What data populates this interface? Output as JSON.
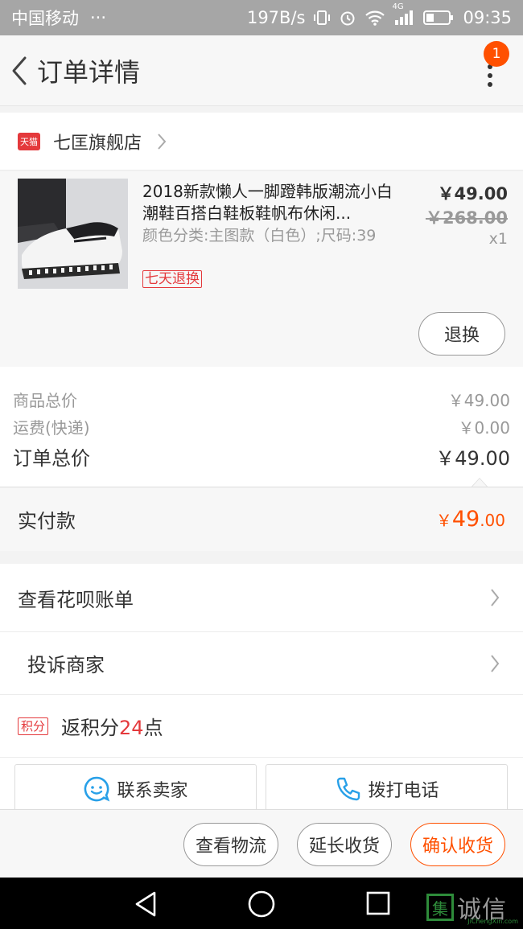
{
  "status_bar": {
    "carrier": "中国移动",
    "dots": "···",
    "speed": "197B/s",
    "network": "4G",
    "time": "09:35"
  },
  "header": {
    "title": "订单详情",
    "badge_count": "1"
  },
  "shop": {
    "logo_text": "天猫",
    "name": "七匡旗舰店"
  },
  "product": {
    "title": "2018新款懒人一脚蹬韩版潮流小白潮鞋百搭白鞋板鞋帆布休闲...",
    "sku": "颜色分类:主图款（白色）;尺码:39",
    "return_tag": "七天退换",
    "price": "￥49.00",
    "original_price": "￥268.00",
    "quantity": "x1",
    "refund_label": "退换"
  },
  "summary": {
    "goods_total_label": "商品总价",
    "goods_total_value": "￥49.00",
    "shipping_label": "运费(快递)",
    "shipping_value": "￥0.00",
    "order_total_label": "订单总价",
    "order_total_value": "￥49.00"
  },
  "payment": {
    "label": "实付款",
    "currency": "￥",
    "integer": "49",
    "decimal": ".00"
  },
  "links": {
    "huabei": "查看花呗账单",
    "complaint": "投诉商家"
  },
  "points": {
    "tag": "积分",
    "prefix": "返积分",
    "count": "24",
    "suffix": "点"
  },
  "contact": {
    "seller": "联系卖家",
    "phone": "拨打电话"
  },
  "actions": {
    "logistics": "查看物流",
    "extend": "延长收货",
    "confirm": "确认收货"
  },
  "watermark": {
    "logo_char": "集",
    "text": "诚信",
    "sub": "JiChengXin.com"
  },
  "colors": {
    "accent": "#ff5000",
    "tmall_red": "#e4393c"
  }
}
